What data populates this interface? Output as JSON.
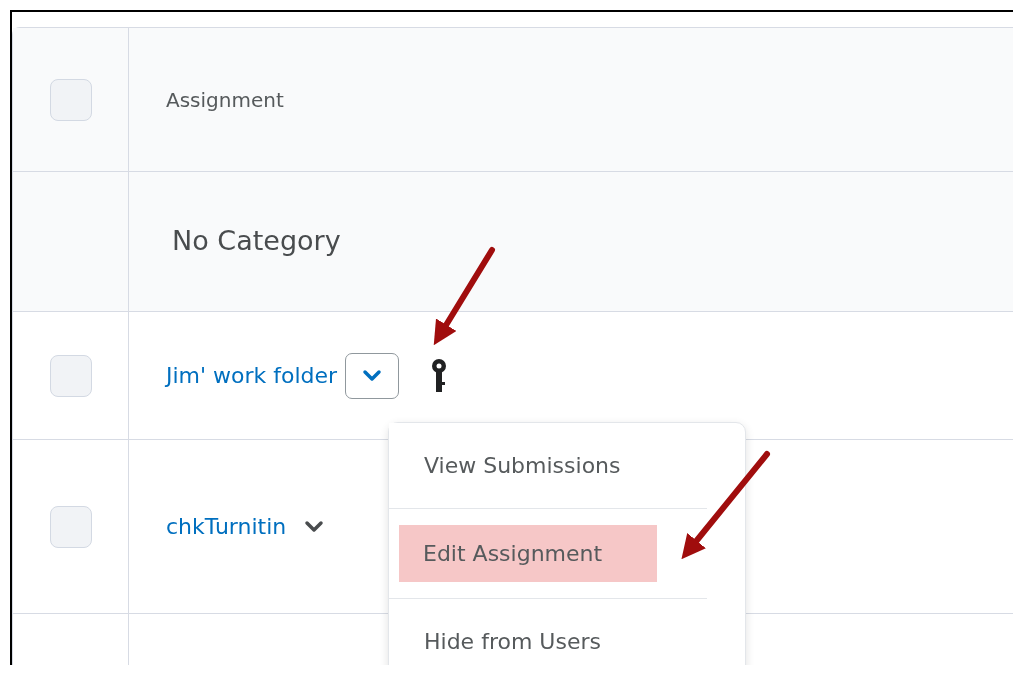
{
  "table": {
    "select_all": {
      "checked": false
    },
    "column_header": "Assignment",
    "category": "No Category",
    "rows": [
      {
        "title": "Jim' work folder",
        "checked": false,
        "menu_open": true,
        "has_key": true
      },
      {
        "title": "chkTurnitin",
        "checked": false,
        "menu_open": false,
        "has_key": false
      }
    ]
  },
  "menu": {
    "items": [
      {
        "label": "View Submissions",
        "highlighted": false
      },
      {
        "label": "Edit Assignment",
        "highlighted": true
      },
      {
        "label": "Hide from Users",
        "highlighted": false
      }
    ]
  }
}
